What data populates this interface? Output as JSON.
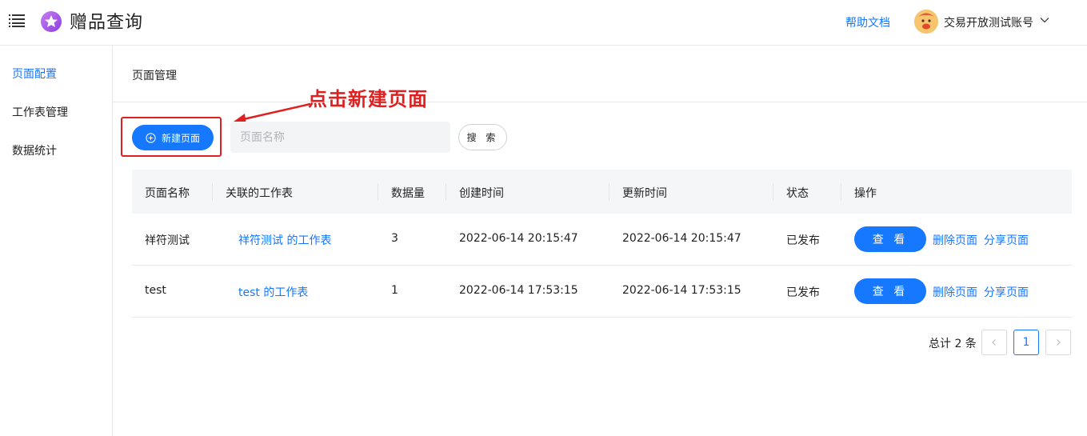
{
  "header": {
    "app_title": "赠品查询",
    "help_link": "帮助文档",
    "account_name": "交易开放测试账号"
  },
  "sidebar": {
    "items": [
      {
        "label": "页面配置",
        "active": true
      },
      {
        "label": "工作表管理",
        "active": false
      },
      {
        "label": "数据统计",
        "active": false
      }
    ]
  },
  "main": {
    "breadcrumb": "页面管理",
    "new_button_label": "新建页面",
    "search_placeholder": "页面名称",
    "search_value": "",
    "search_button_label": "搜 索",
    "annotation_text": "点击新建页面"
  },
  "table": {
    "columns": [
      "页面名称",
      "关联的工作表",
      "数据量",
      "创建时间",
      "更新时间",
      "状态",
      "操作"
    ],
    "rows": [
      {
        "name": "祥符测试",
        "sheet": "祥符测试 的工作表",
        "count": "3",
        "created": "2022-06-14 20:15:47",
        "updated": "2022-06-14 20:15:47",
        "status": "已发布",
        "view": "查 看",
        "delete": "删除页面",
        "share": "分享页面"
      },
      {
        "name": "test",
        "sheet": "test 的工作表",
        "count": "1",
        "created": "2022-06-14 17:53:15",
        "updated": "2022-06-14 17:53:15",
        "status": "已发布",
        "view": "查 看",
        "delete": "删除页面",
        "share": "分享页面"
      }
    ]
  },
  "pagination": {
    "total_text": "总计 2 条",
    "prev": "<",
    "current_page": "1",
    "next": ">"
  },
  "colors": {
    "accent": "#1677ff",
    "annotation": "#e02020"
  }
}
